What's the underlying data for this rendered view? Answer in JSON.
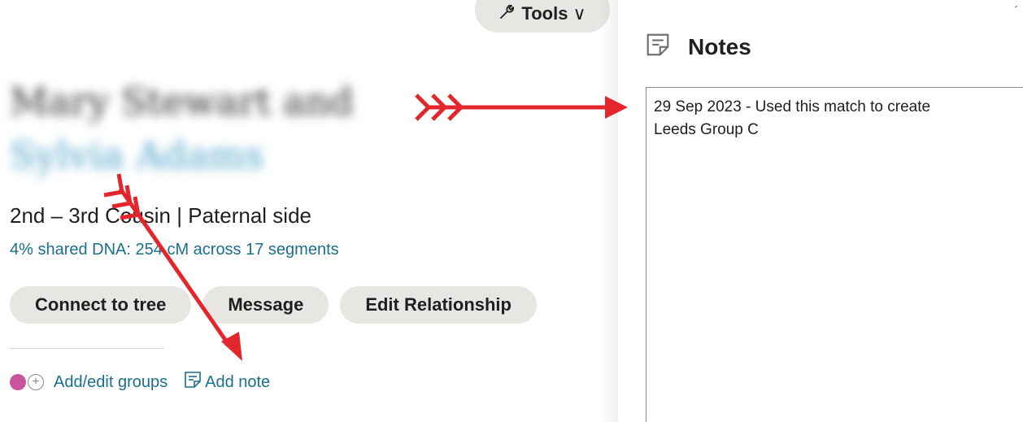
{
  "toolbar": {
    "tools_label": "Tools",
    "tools_chevron": "∨",
    "tools_icon": "wrench-icon"
  },
  "match": {
    "name_line1": "Mary Stewart and",
    "name_line2": "Sylvia Adams",
    "relationship": "2nd – 3rd Cousin | Paternal side",
    "shared_dna": "4% shared DNA: 254 cM across 17 segments"
  },
  "actions": {
    "connect_to_tree": "Connect to tree",
    "message": "Message",
    "edit_relationship": "Edit Relationship"
  },
  "footer": {
    "add_edit_groups": "Add/edit groups",
    "add_note": "Add note",
    "group_dot_color": "#c9549b"
  },
  "notes_panel": {
    "title": "Notes",
    "note_text": "29 Sep 2023 - Used this match to create\n Leeds Group C",
    "corner_glyph": "ˊ"
  },
  "annotation": {
    "arrow_color": "#e3262c"
  }
}
